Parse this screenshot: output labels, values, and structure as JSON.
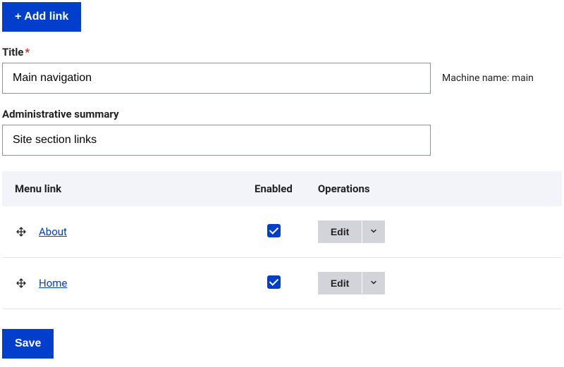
{
  "buttons": {
    "add_link": "+ Add link",
    "save": "Save"
  },
  "fields": {
    "title": {
      "label": "Title",
      "required_marker": "*",
      "value": "Main navigation"
    },
    "machine_name": {
      "prefix": "Machine name: ",
      "value": "main"
    },
    "admin_summary": {
      "label": "Administrative summary",
      "value": "Site section links"
    }
  },
  "table": {
    "headers": {
      "menu_link": "Menu link",
      "enabled": "Enabled",
      "operations": "Operations"
    },
    "rows": [
      {
        "label": "About",
        "enabled": true,
        "op_label": "Edit"
      },
      {
        "label": "Home",
        "enabled": true,
        "op_label": "Edit"
      }
    ]
  }
}
